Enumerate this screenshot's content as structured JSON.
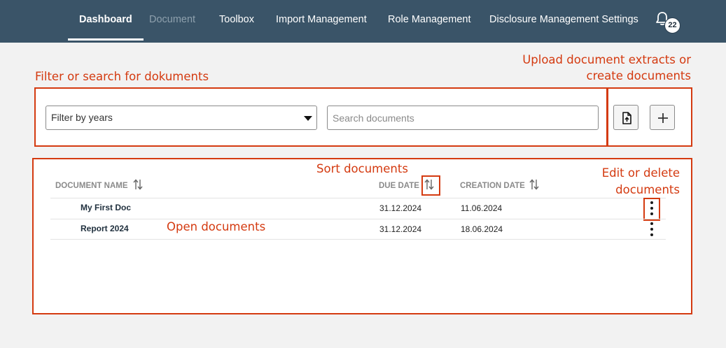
{
  "nav": {
    "items": [
      {
        "label": "Dashboard",
        "state": "active"
      },
      {
        "label": "Document",
        "state": "disabled"
      },
      {
        "label": "Toolbox",
        "state": "normal"
      },
      {
        "label": "Import Management",
        "state": "normal"
      },
      {
        "label": "Role Management",
        "state": "normal"
      },
      {
        "label": "Disclosure Management Settings",
        "state": "normal"
      }
    ],
    "notification_icon": "bell-icon",
    "notification_count": "22"
  },
  "annotations": {
    "filter": "Filter or search for dokuments",
    "upload_line1": "Upload document extracts or",
    "upload_line2": "create documents",
    "sort": "Sort documents",
    "edit_line1": "Edit or delete",
    "edit_line2": "documents",
    "open": "Open documents"
  },
  "toolbar": {
    "year_filter_value": "Filter by years",
    "search_placeholder": "Search documents",
    "upload_icon": "file-upload-icon",
    "add_icon": "plus-icon"
  },
  "table": {
    "columns": [
      "DOCUMENT NAME",
      "DUE DATE",
      "CREATION DATE"
    ],
    "sort_icon": "sort-arrows-icon",
    "row_menu_icon": "more-vertical-icon",
    "rows": [
      {
        "name": "My First Doc",
        "due_date": "31.12.2024",
        "creation_date": "11.06.2024"
      },
      {
        "name": "Report 2024",
        "due_date": "31.12.2024",
        "creation_date": "18.06.2024"
      }
    ]
  },
  "colors": {
    "topbar": "#3a5468",
    "annotation": "#d43a10",
    "background": "#f2f2f2"
  }
}
